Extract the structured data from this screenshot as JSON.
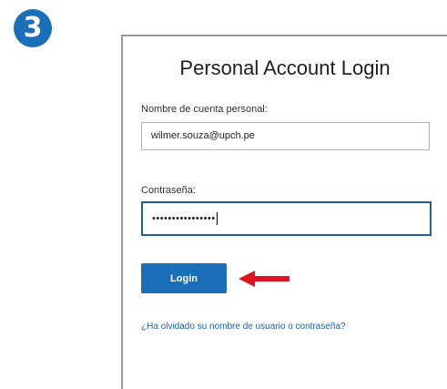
{
  "step_badge": "3",
  "login": {
    "title": "Personal Account Login",
    "username_label": "Nombre de cuenta personal:",
    "username_value": "wilmer.souza@upch.pe",
    "password_label": "Contraseña:",
    "password_masked": "••••••••••••••••",
    "button_label": "Login",
    "forgot_link": "¿Ha olvidado su nombre de usuario o contraseña?"
  },
  "colors": {
    "accent": "#1a6fb8",
    "arrow": "#e0141e",
    "link": "#1a5fa8"
  },
  "icons": {
    "pointer": "red-arrow-icon"
  }
}
